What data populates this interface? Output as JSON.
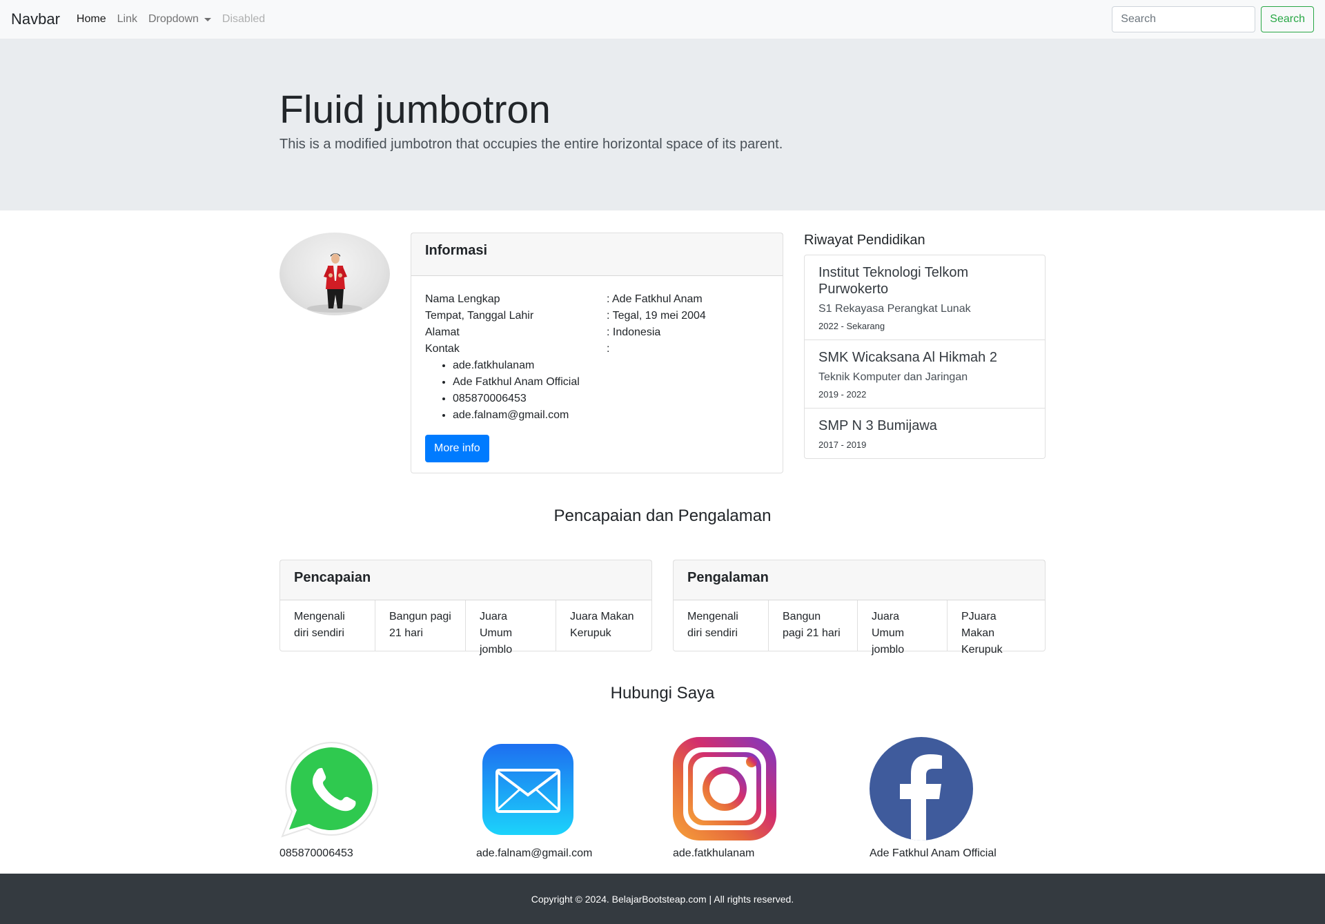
{
  "navbar": {
    "brand": "Navbar",
    "links": [
      {
        "label": "Home",
        "state": "active"
      },
      {
        "label": "Link",
        "state": "normal"
      },
      {
        "label": "Dropdown",
        "state": "normal"
      },
      {
        "label": "Disabled",
        "state": "disabled"
      }
    ],
    "search_placeholder": "Search",
    "search_button": "Search"
  },
  "jumbotron": {
    "title": "Fluid jumbotron",
    "lead": "This is a modified jumbotron that occupies the entire horizontal space of its parent."
  },
  "informasi": {
    "title": "Informasi",
    "rows": [
      {
        "label": "Nama Lengkap",
        "value": ": Ade Fatkhul Anam"
      },
      {
        "label": "Tempat, Tanggal Lahir",
        "value": ": Tegal, 19 mei 2004"
      },
      {
        "label": "Alamat",
        "value": ": Indonesia"
      },
      {
        "label": "Kontak",
        "value": ":"
      }
    ],
    "contacts": [
      "ade.fatkhulanam",
      "Ade Fatkhul Anam Official",
      "085870006453",
      "ade.falnam@gmail.com"
    ],
    "button": "More info"
  },
  "pendidikan": {
    "title": "Riwayat Pendidikan",
    "items": [
      {
        "name": "Institut Teknologi Telkom Purwokerto",
        "program": "S1 Rekayasa Perangkat Lunak",
        "years": "2022 - Sekarang"
      },
      {
        "name": "SMK Wicaksana Al Hikmah 2",
        "program": "Teknik Komputer dan Jaringan",
        "years": "2019 - 2022"
      },
      {
        "name": "SMP N 3 Bumijawa",
        "program": "",
        "years": "2017 - 2019"
      }
    ]
  },
  "pencapaian_section": {
    "title": "Pencapaian dan Pengalaman",
    "pencapaian": {
      "title": "Pencapaian",
      "items": [
        "Mengenali diri sendiri",
        "Bangun pagi 21 hari",
        "Juara Umum jomblo",
        "Juara Makan Kerupuk"
      ]
    },
    "pengalaman": {
      "title": "Pengalaman",
      "items": [
        "Mengenali diri sendiri",
        "Bangun pagi 21 hari",
        "Juara Umum jomblo",
        "PJuara Makan Kerupuk"
      ]
    }
  },
  "hubungi": {
    "title": "Hubungi Saya",
    "items": [
      {
        "icon": "whatsapp-icon",
        "label": "085870006453",
        "color": "#25d366"
      },
      {
        "icon": "mail-icon",
        "label": "ade.falnam@gmail.com",
        "color": "#1e8af3"
      },
      {
        "icon": "instagram-icon",
        "label": "ade.fatkhulanam",
        "color": "#c13584"
      },
      {
        "icon": "facebook-icon",
        "label": "Ade Fatkhul Anam Official",
        "color": "#3b5998"
      }
    ]
  },
  "footer": {
    "text": "Copyright © 2024. BelajarBootsteap.com | All rights reserved."
  },
  "colors": {
    "primary": "#007bff",
    "success": "#28a745",
    "jumbotron_bg": "#e9ecef",
    "navbar_bg": "#f8f9fa",
    "footer_bg": "#343a40"
  }
}
